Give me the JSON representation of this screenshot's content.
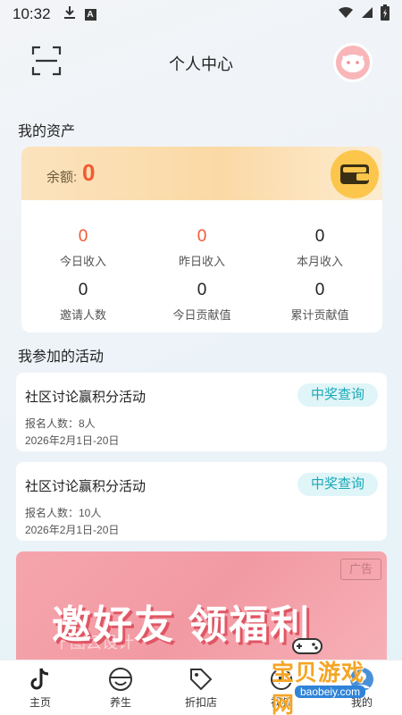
{
  "status_bar": {
    "time": "10:32",
    "icons": [
      "download-icon",
      "a-notification-icon",
      "wifi-icon",
      "signal-icon",
      "battery-charging-icon"
    ]
  },
  "header": {
    "title": "个人中心",
    "scan_icon": "scan-icon",
    "avatar_icon": "avatar"
  },
  "assets": {
    "section_title": "我的资产",
    "balance_label": "余额:",
    "balance_value": "0",
    "wallet_icon": "wallet-icon",
    "stats": [
      {
        "value": "0",
        "label": "今日收入",
        "highlight": true
      },
      {
        "value": "0",
        "label": "昨日收入",
        "highlight": true
      },
      {
        "value": "0",
        "label": "本月收入",
        "highlight": false
      },
      {
        "value": "0",
        "label": "邀请人数",
        "highlight": false
      },
      {
        "value": "0",
        "label": "今日贡献值",
        "highlight": false
      },
      {
        "value": "0",
        "label": "累计贡献值",
        "highlight": false
      }
    ]
  },
  "activities": {
    "section_title": "我参加的活动",
    "items": [
      {
        "title": "社区讨论赢积分活动",
        "people": "报名人数：8人",
        "date": "2026年2月1日-20日",
        "button": "中奖查询"
      },
      {
        "title": "社区讨论赢积分活动",
        "people": "报名人数：10人",
        "date": "2026年2月1日-20日",
        "button": "中奖查询"
      }
    ]
  },
  "ad": {
    "tag": "广告",
    "headline": "邀好友 领福利",
    "watermark": "千图云设计"
  },
  "tabbar": {
    "items": [
      {
        "label": "主页",
        "icon": "music-note-icon"
      },
      {
        "label": "养生",
        "icon": "bowl-icon"
      },
      {
        "label": "折扣店",
        "icon": "tag-icon"
      },
      {
        "label": "视频",
        "icon": "video-icon"
      },
      {
        "label": "我的",
        "icon": "user-icon"
      }
    ]
  },
  "overlay": {
    "logo_text": "宝贝游戏网",
    "logo_url": "baobeiy.com"
  },
  "colors": {
    "accent_red": "#f25a32",
    "teal_button": "#1aa8b8",
    "gold": "#fbc64b"
  }
}
